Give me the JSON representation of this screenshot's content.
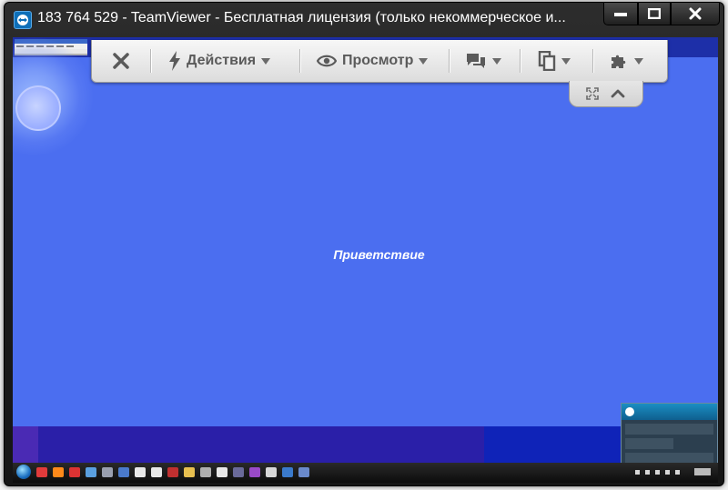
{
  "window": {
    "title": "183 764 529 - TeamViewer - Бесплатная лицензия (только некоммерческое и...",
    "icons": {
      "app": "teamviewer-logo-icon",
      "minimize": "minimize-icon",
      "maximize": "maximize-icon",
      "close": "close-icon"
    }
  },
  "toolbar": {
    "close_icon": "close-icon",
    "actions": {
      "label": "Действия",
      "icon": "lightning-icon"
    },
    "view": {
      "label": "Просмотр",
      "icon": "eye-icon"
    },
    "communicate": {
      "icon": "chat-bubbles-icon"
    },
    "files": {
      "icon": "files-icon"
    },
    "extras": {
      "icon": "puzzle-icon"
    },
    "subtab": {
      "fullscreen_icon": "fullscreen-icon",
      "collapse_icon": "chevron-up-icon"
    }
  },
  "remote": {
    "welcome_text": "Приветствие",
    "colors": {
      "desktop": "#4b6ef0",
      "bottom_band": "#0f23b8"
    }
  }
}
